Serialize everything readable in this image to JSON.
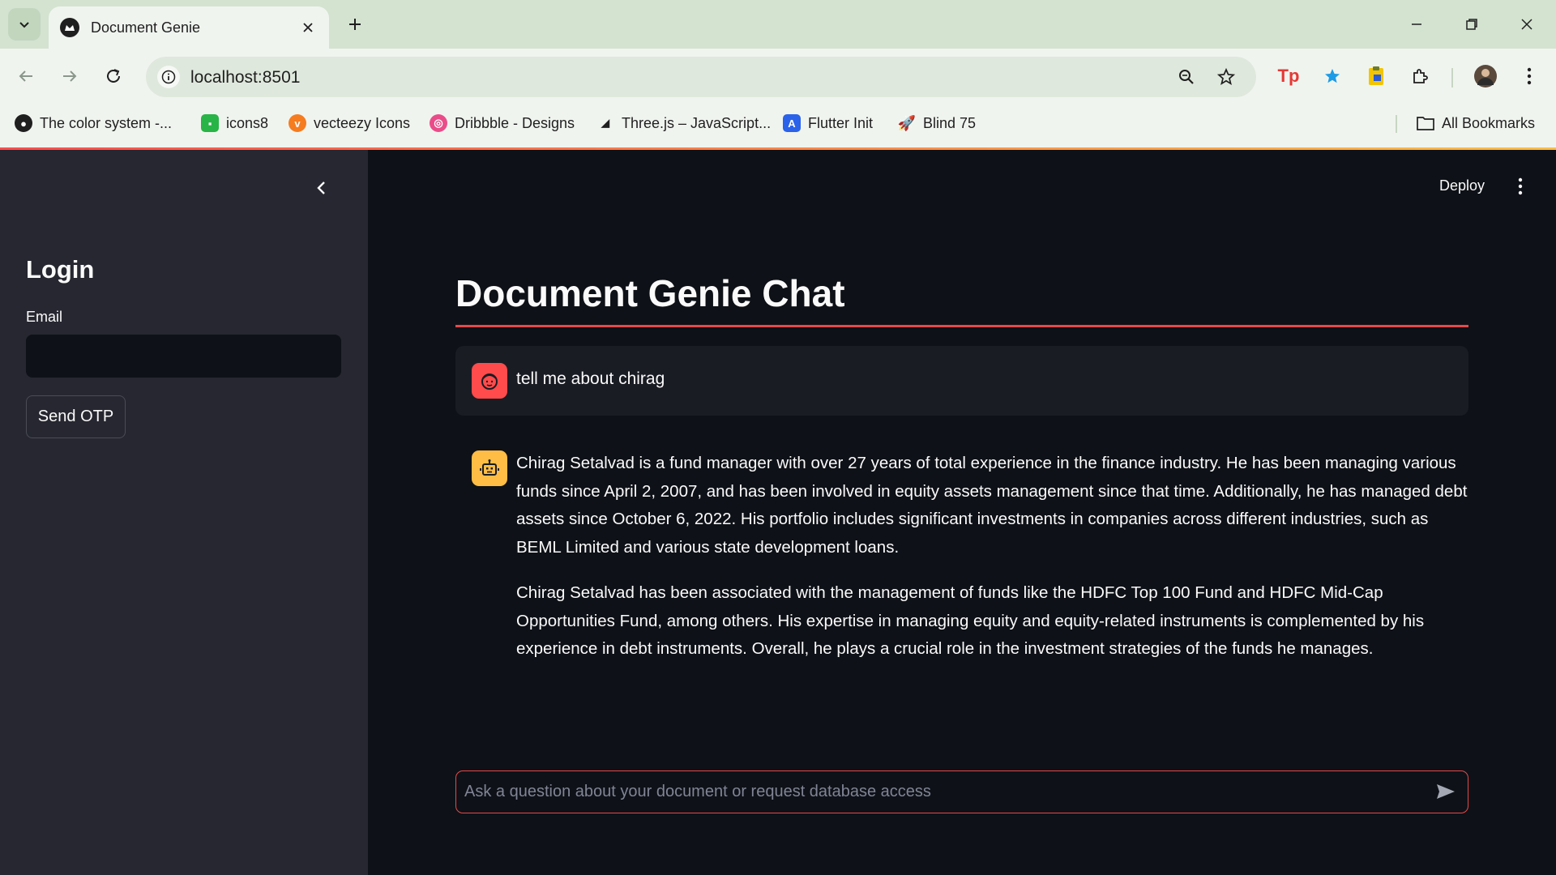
{
  "browser": {
    "tab_title": "Document Genie",
    "url": "localhost:8501",
    "bookmarks": [
      {
        "label": "The color system -...",
        "icon": "github-icon"
      },
      {
        "label": "icons8",
        "icon": "icons8-icon"
      },
      {
        "label": "vecteezy Icons",
        "icon": "vecteezy-icon"
      },
      {
        "label": "Dribbble - Designs",
        "icon": "dribbble-icon"
      },
      {
        "label": "Three.js – JavaScript...",
        "icon": "threejs-icon"
      },
      {
        "label": "Flutter Init",
        "icon": "flutter-icon"
      },
      {
        "label": "Blind 75",
        "icon": "rocket-icon"
      }
    ],
    "all_bookmarks": "All Bookmarks"
  },
  "sidebar": {
    "heading": "Login",
    "email_label": "Email",
    "email_value": "",
    "send_otp": "Send OTP"
  },
  "header": {
    "deploy": "Deploy"
  },
  "main": {
    "title": "Document Genie Chat",
    "messages": [
      {
        "role": "user",
        "text": "tell me about chirag"
      },
      {
        "role": "assistant",
        "paragraphs": [
          "Chirag Setalvad is a fund manager with over 27 years of total experience in the finance industry. He has been managing various funds since April 2, 2007, and has been involved in equity assets management since that time. Additionally, he has managed debt assets since October 6, 2022. His portfolio includes significant investments in companies across different industries, such as BEML Limited and various state development loans.",
          "Chirag Setalvad has been associated with the management of funds like the HDFC Top 100 Fund and HDFC Mid-Cap Opportunities Fund, among others. His expertise in managing equity and equity-related instruments is complemented by his experience in debt instruments. Overall, he plays a crucial role in the investment strategies of the funds he manages."
        ]
      }
    ],
    "chat_placeholder": "Ask a question about your document or request database access"
  },
  "colors": {
    "accent": "#ff4b4b",
    "assistant_avatar": "#ffbd45",
    "sidebar_bg": "#262730",
    "main_bg": "#0e1117"
  }
}
